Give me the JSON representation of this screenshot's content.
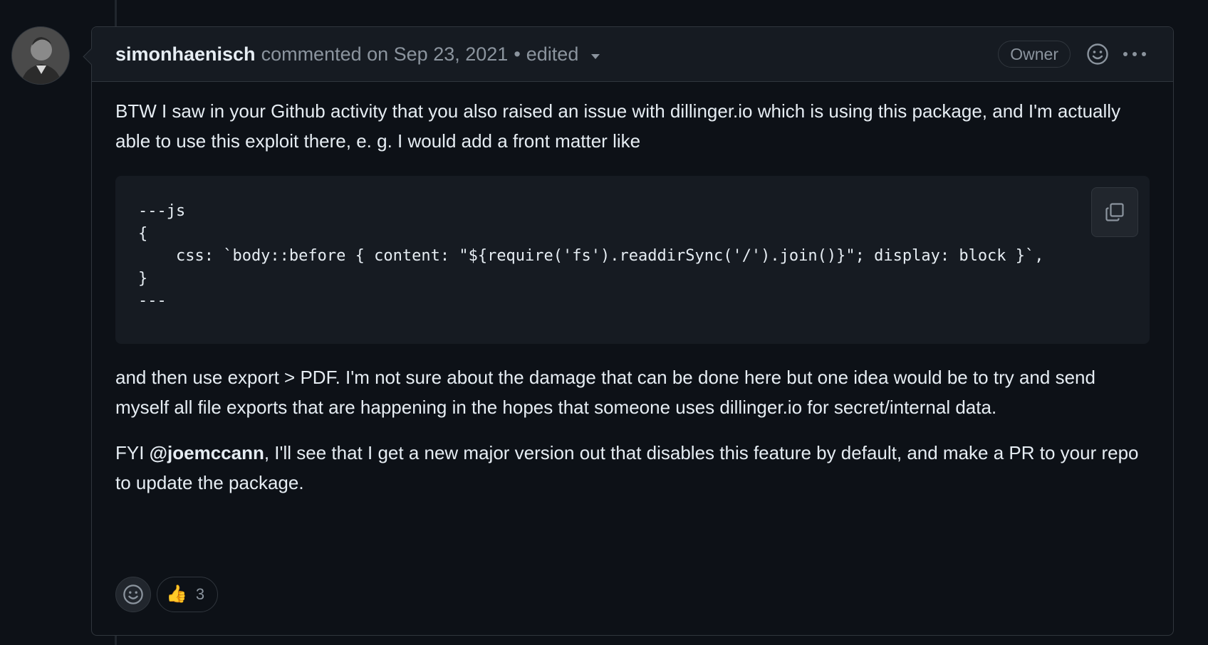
{
  "comment": {
    "author": "simonhaenisch",
    "action_text": "commented on Sep 23, 2021",
    "separator": "•",
    "edited_label": "edited",
    "role_badge": "Owner",
    "icons": {
      "add_reaction": "smiley-icon",
      "more": "kebab-horizontal-icon",
      "copy": "copy-icon",
      "avatar": "avatar-image",
      "dropdown": "triangle-down-icon"
    },
    "body": {
      "paragraph_1": "BTW I saw in your Github activity that you also raised an issue with dillinger.io which is using this package, and I'm actually able to use this exploit there, e. g. I would add a front matter like",
      "code": "---js\n{\n    css: `body::before { content: \"${require('fs').readdirSync('/').join()}\"; display: block }`,\n}\n---",
      "paragraph_2": "and then use export > PDF. I'm not sure about the damage that can be done here but one idea would be to try and send myself all file exports that are happening in the hopes that someone uses dillinger.io for secret/internal data.",
      "paragraph_3_prefix": "FYI ",
      "mention": "@joemccann",
      "paragraph_3_suffix": ", I'll see that I get a new major version out that disables this feature by default, and make a PR to your repo to update the package."
    },
    "reactions": [
      {
        "emoji": "👍",
        "count": "3",
        "icon": "thumbs-up-icon"
      }
    ]
  },
  "colors": {
    "background": "#0d1117",
    "header_bg": "#161b22",
    "border": "#30363d",
    "text": "#e6edf3",
    "muted": "#8b949e"
  }
}
